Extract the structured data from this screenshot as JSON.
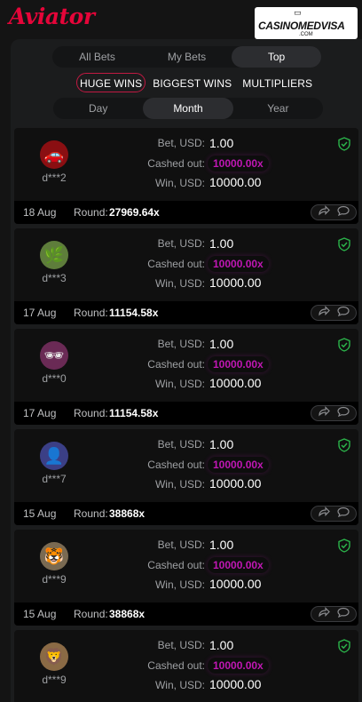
{
  "app": {
    "brand": "Aviator",
    "watermark": {
      "main": "CASINOMEDVISA",
      "sub": ".COM"
    }
  },
  "tabs": [
    {
      "label": "All Bets",
      "active": false
    },
    {
      "label": "My Bets",
      "active": false
    },
    {
      "label": "Top",
      "active": true
    }
  ],
  "filters": [
    {
      "label": "HUGE WINS",
      "active": true
    },
    {
      "label": "BIGGEST WINS",
      "active": false
    },
    {
      "label": "MULTIPLIERS",
      "active": false
    }
  ],
  "periods": [
    {
      "label": "Day",
      "active": false
    },
    {
      "label": "Month",
      "active": true
    },
    {
      "label": "Year",
      "active": false
    }
  ],
  "labels": {
    "bet": "Bet, USD:",
    "cashed_out": "Cashed out:",
    "win": "Win, USD:",
    "round": "Round:"
  },
  "cards": [
    {
      "user": "d***2",
      "avatar_icon": "car-avatar-icon",
      "avatar_color": "#8a0f12",
      "bet": "1.00",
      "cashed_out": "10000.00x",
      "win": "10000.00",
      "date": "18 Aug",
      "round": "27969.64x"
    },
    {
      "user": "d***3",
      "avatar_icon": "leaf-avatar-icon",
      "avatar_color": "#5e7d3b",
      "bet": "1.00",
      "cashed_out": "10000.00x",
      "win": "10000.00",
      "date": "17 Aug",
      "round": "11154.58x"
    },
    {
      "user": "d***0",
      "avatar_icon": "sunglasses-avatar-icon",
      "avatar_color": "#6a2a55",
      "bet": "1.00",
      "cashed_out": "10000.00x",
      "win": "10000.00",
      "date": "17 Aug",
      "round": "11154.58x"
    },
    {
      "user": "d***7",
      "avatar_icon": "hooded-figure-avatar-icon",
      "avatar_color": "#3b3f86",
      "bet": "1.00",
      "cashed_out": "10000.00x",
      "win": "10000.00",
      "date": "15 Aug",
      "round": "38868x"
    },
    {
      "user": "d***9",
      "avatar_icon": "tiger-avatar-icon",
      "avatar_color": "#7a6a52",
      "bet": "1.00",
      "cashed_out": "10000.00x",
      "win": "10000.00",
      "date": "15 Aug",
      "round": "38868x"
    },
    {
      "user": "d***9",
      "avatar_icon": "lion-avatar-icon",
      "avatar_color": "#8a6a45",
      "bet": "1.00",
      "cashed_out": "10000.00x",
      "win": "10000.00",
      "date": "",
      "round": ""
    }
  ],
  "colors": {
    "brand": "#e50539",
    "multiplier": "#c017b4",
    "verified": "#2bb34a",
    "active_border": "#c01942"
  }
}
